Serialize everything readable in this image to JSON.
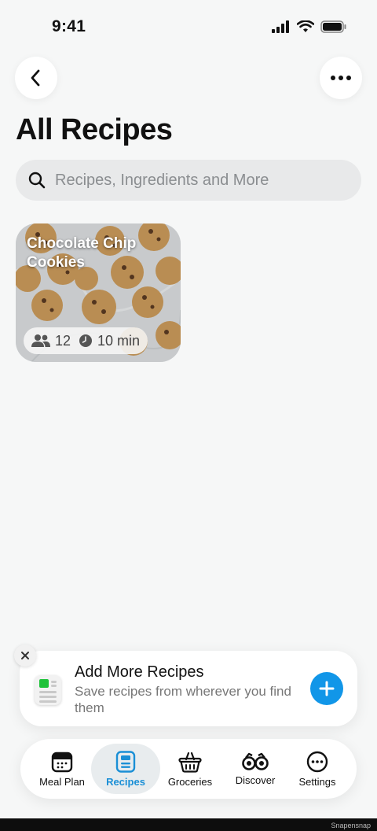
{
  "status": {
    "time": "9:41"
  },
  "header": {
    "title": "All Recipes"
  },
  "search": {
    "placeholder": "Recipes, Ingredients and More"
  },
  "recipes": [
    {
      "title": "Chocolate Chip Cookies",
      "servings": "12",
      "time": "10 min"
    }
  ],
  "promo": {
    "title": "Add More Recipes",
    "subtitle": "Save recipes from wherever you find them"
  },
  "tabs": [
    {
      "label": "Meal Plan",
      "icon": "meal-plan-icon"
    },
    {
      "label": "Recipes",
      "icon": "recipes-icon",
      "active": true
    },
    {
      "label": "Groceries",
      "icon": "basket-icon"
    },
    {
      "label": "Discover",
      "icon": "binoculars-icon"
    },
    {
      "label": "Settings",
      "icon": "settings-icon"
    }
  ],
  "watermark": "Snapensnap",
  "colors": {
    "accent": "#1196e8",
    "active_tab_text": "#1a8fd6",
    "background": "#f6f7f7"
  }
}
